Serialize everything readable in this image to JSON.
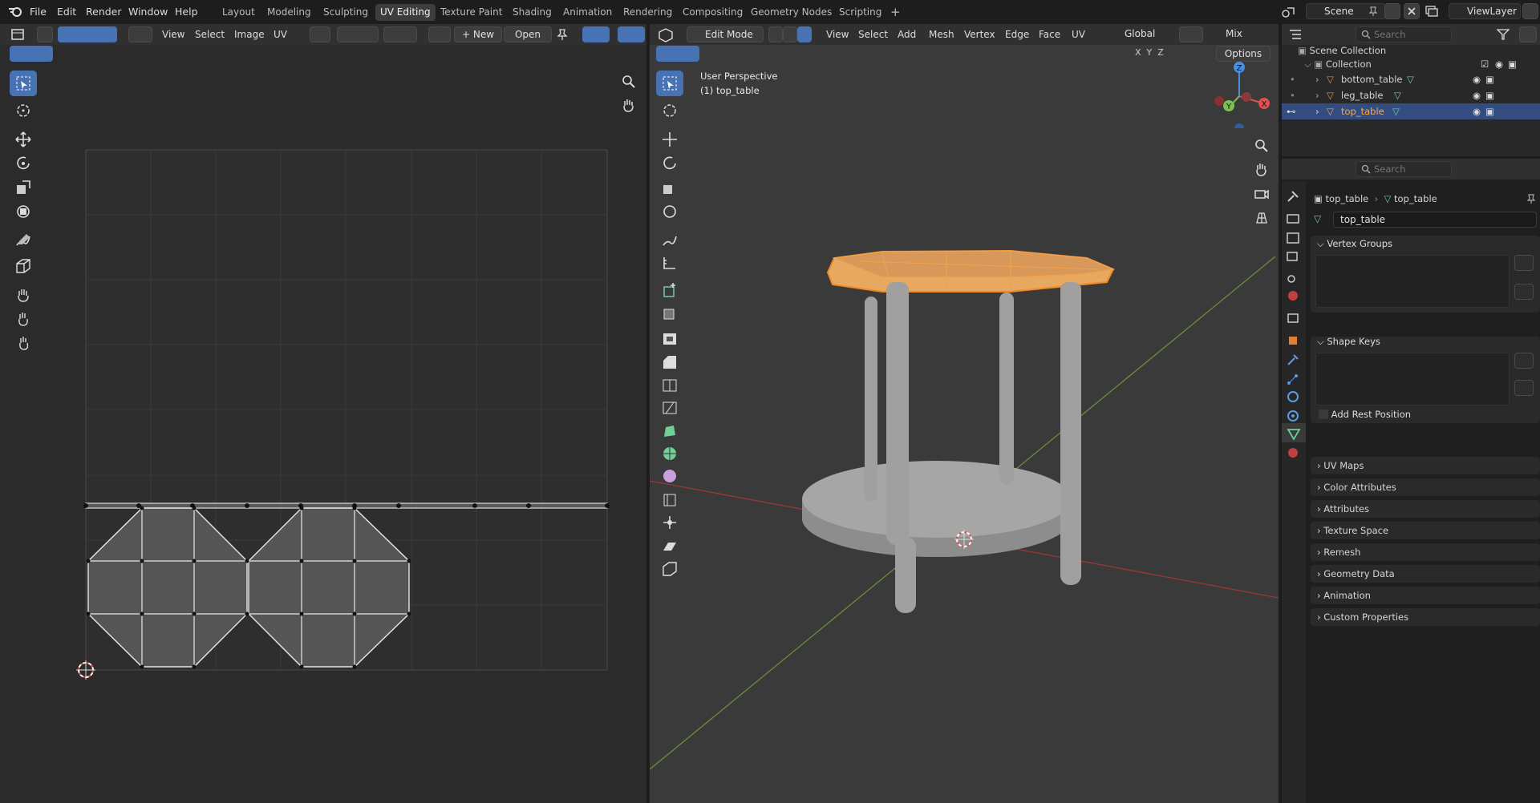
{
  "topbar": {
    "menus": [
      "File",
      "Edit",
      "Render",
      "Window",
      "Help"
    ],
    "workspaces": [
      "Layout",
      "Modeling",
      "Sculpting",
      "UV Editing",
      "Texture Paint",
      "Shading",
      "Animation",
      "Rendering",
      "Compositing",
      "Geometry Nodes",
      "Scripting"
    ],
    "add": "+",
    "scene": "Scene",
    "view_layer": "ViewLayer"
  },
  "uv_editor": {
    "menus": [
      "View",
      "Select",
      "Image",
      "UV"
    ],
    "new_label": "New",
    "open_label": "Open"
  },
  "viewport": {
    "mode": "Edit Mode",
    "menus": [
      "View",
      "Select",
      "Add",
      "Mesh",
      "Vertex",
      "Edge",
      "Face",
      "UV"
    ],
    "orientation": "Global",
    "snap": "Mix",
    "axes": [
      "X",
      "Y",
      "Z"
    ],
    "options": "Options",
    "info_line1": "User Perspective",
    "info_line2": "(1) top_table",
    "gizmo": {
      "x": "X",
      "y": "Y",
      "z": "Z"
    },
    "colors": {
      "selected": "#f08a24",
      "mesh": "#8f8f8f"
    }
  },
  "outliner": {
    "search_placeholder": "Search",
    "scene_collection": "Scene Collection",
    "collection": "Collection",
    "objects": [
      "bottom_table",
      "leg_table",
      "top_table"
    ],
    "active": "top_table"
  },
  "properties": {
    "search_placeholder": "Search",
    "breadcrumb_object": "top_table",
    "breadcrumb_mesh": "top_table",
    "mesh_name": "top_table",
    "vertex_groups": "Vertex Groups",
    "shape_keys": "Shape Keys",
    "add_rest_position": "Add Rest Position",
    "sections": [
      "UV Maps",
      "Color Attributes",
      "Attributes",
      "Texture Space",
      "Remesh",
      "Geometry Data",
      "Animation",
      "Custom Properties"
    ]
  }
}
